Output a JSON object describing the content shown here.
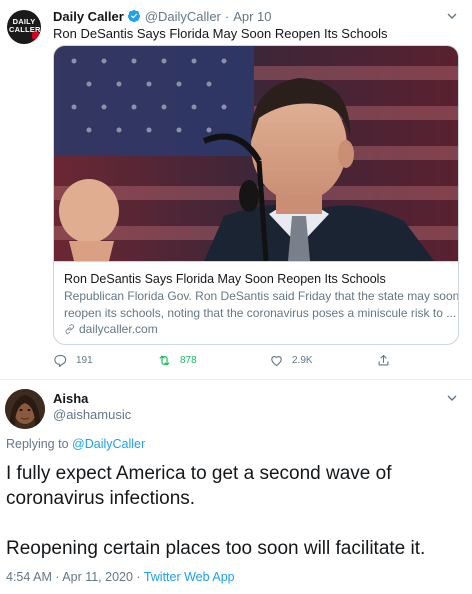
{
  "tweet1": {
    "name": "Daily Caller",
    "handle": "@DailyCaller",
    "separator": "·",
    "date": "Apr 10",
    "text": "Ron DeSantis Says Florida May Soon Reopen Its Schools",
    "avatar_text": [
      "DAILY",
      "CALLER"
    ],
    "icons": {
      "verified": "verified-badge-icon",
      "more": "chevron-down-icon"
    },
    "card": {
      "title": "Ron DeSantis Says Florida May Soon Reopen Its Schools",
      "description_line1": "Republican Florida Gov. Ron DeSantis said Friday that the state may soon",
      "description_line2": "reopen its schools, noting that the coronavirus poses a miniscule risk to ...",
      "domain": "dailycaller.com"
    },
    "actions": {
      "replies": "191",
      "retweets": "878",
      "likes": "2.9K"
    }
  },
  "tweet2": {
    "name": "Aisha",
    "handle": "@aishamusic",
    "replying_prefix": "Replying to",
    "replying_to": "@DailyCaller",
    "text_line1": "I fully expect America to get a second wave of",
    "text_line2": "coronavirus infections.",
    "text_line3": "Reopening certain places too soon will facilitate it.",
    "timestamp": "4:54 AM · Apr 11, 2020 · ",
    "source": "Twitter Web App"
  },
  "colors": {
    "link": "#1da1f2",
    "secondary_text": "#657786",
    "retweet_active": "#17bf63",
    "border": "#ccd6dd"
  }
}
